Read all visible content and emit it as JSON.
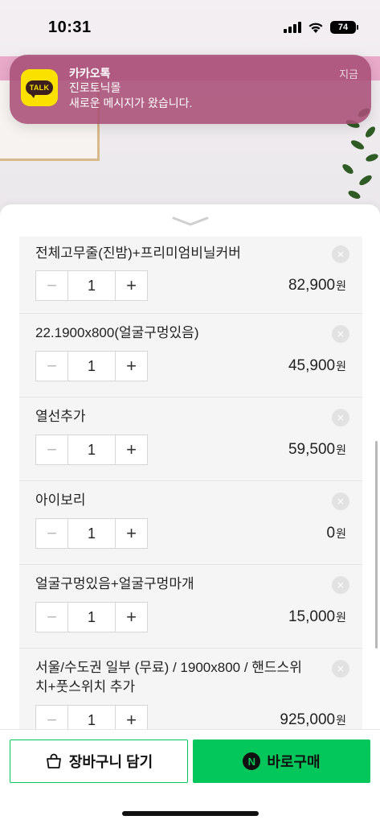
{
  "status_bar": {
    "time": "10:31",
    "battery": "74"
  },
  "notification": {
    "app_name": "카카오톡",
    "app_icon_text": "TALK",
    "sender": "진로토닉몰",
    "message": "새로운 메시지가 왔습니다.",
    "time": "지금"
  },
  "options": [
    {
      "name": "전체고무줄(진밤)+프리미엄비닐커버",
      "quantity": "1",
      "price": "82,900",
      "currency": "원"
    },
    {
      "name": "22.1900x800(얼굴구멍있음)",
      "quantity": "1",
      "price": "45,900",
      "currency": "원"
    },
    {
      "name": "열선추가",
      "quantity": "1",
      "price": "59,500",
      "currency": "원"
    },
    {
      "name": "아이보리",
      "quantity": "1",
      "price": "0",
      "currency": "원"
    },
    {
      "name": "얼굴구멍있음+얼굴구멍마개",
      "quantity": "1",
      "price": "15,000",
      "currency": "원"
    },
    {
      "name": "서울/수도권 일부 (무료) / 1900x800 / 핸드스위치+풋스위치 추가",
      "quantity": "1",
      "price": "925,000",
      "currency": "원"
    }
  ],
  "stepper": {
    "minus": "−",
    "plus": "+"
  },
  "remove_symbol": "×",
  "actions": {
    "cart_label": "장바구니 담기",
    "buy_label": "바로구매",
    "buy_badge": "N"
  },
  "colors": {
    "accent_green": "#03c75a",
    "kakao_yellow": "#fae100",
    "notification_bg": "#a84e76"
  },
  "icons": [
    "shopping-bag-icon",
    "naver-pay-icon",
    "chevron-down-icon",
    "remove-icon"
  ]
}
